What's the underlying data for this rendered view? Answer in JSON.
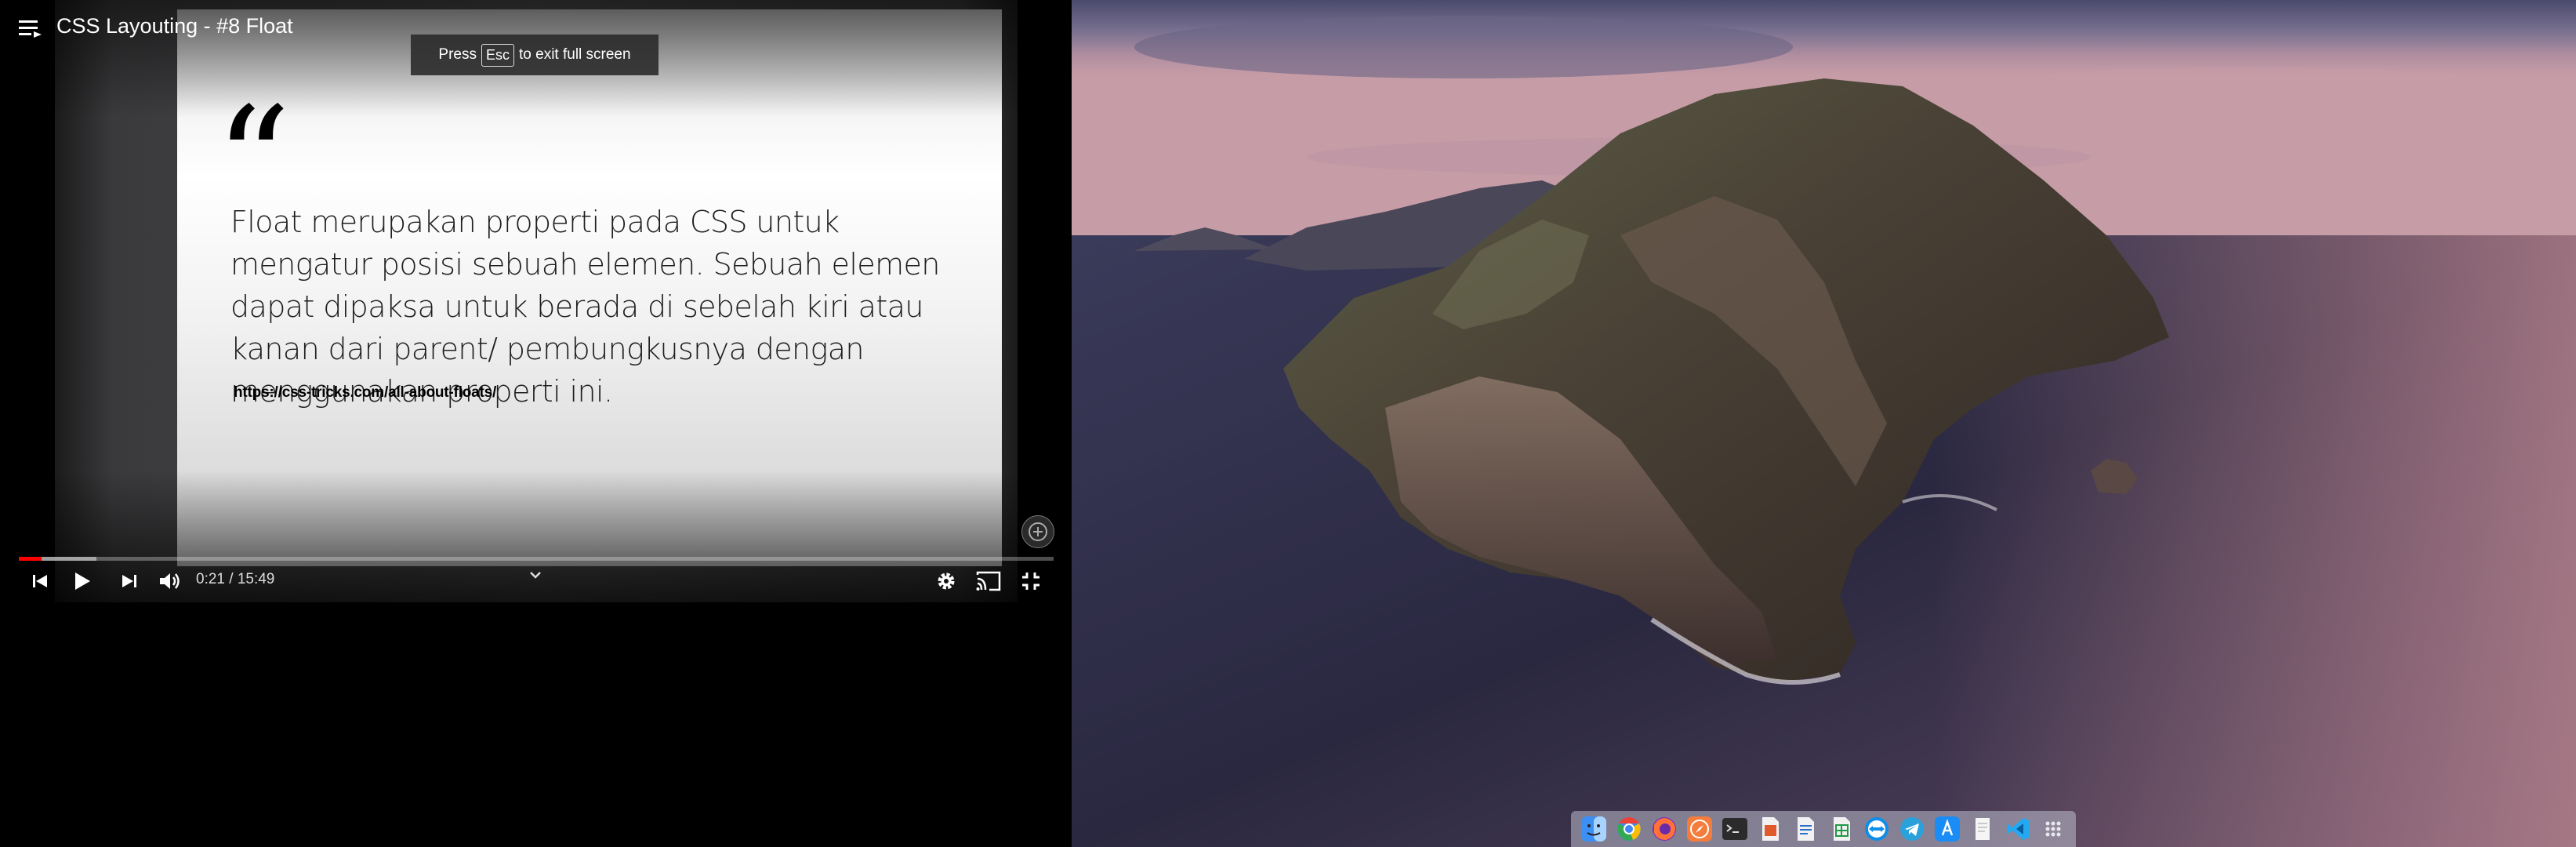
{
  "player": {
    "title": "CSS Layouting - #8 Float",
    "toast": {
      "press": "Press",
      "key": "Esc",
      "rest": "to exit full screen"
    },
    "slide": {
      "quote_mark": "“",
      "text": "Float merupakan properti pada CSS untuk mengatur posisi sebuah elemen. Sebuah elemen dapat dipaksa untuk berada di sebelah kiri atau kanan dari parent/ pembungkusnya dengan menggunakan properti ini.",
      "link": "https://css-tricks.com/all-about-floats/"
    },
    "time": "0:21 / 15:49",
    "progress_fraction": 0.022,
    "buffer_fraction": 0.075,
    "controls": [
      "previous-icon",
      "play-icon",
      "next-icon",
      "volume-icon",
      "settings-icon",
      "cast-icon",
      "exit-fullscreen-icon"
    ]
  },
  "dock": {
    "apps": [
      "finder-icon",
      "chrome-icon",
      "firefox-icon",
      "safari-icon",
      "terminal-icon",
      "documents-icon",
      "writer-icon",
      "calc-icon",
      "teamviewer-icon",
      "telegram-icon",
      "app-store-icon",
      "notes-icon",
      "vscode-icon",
      "launchpad-icon"
    ]
  },
  "colors": {
    "progress": "#ff0000",
    "chrome": "#4285f4",
    "firefox": "#ff7139",
    "telegram": "#2aa1da",
    "vscode": "#23a9f2"
  }
}
